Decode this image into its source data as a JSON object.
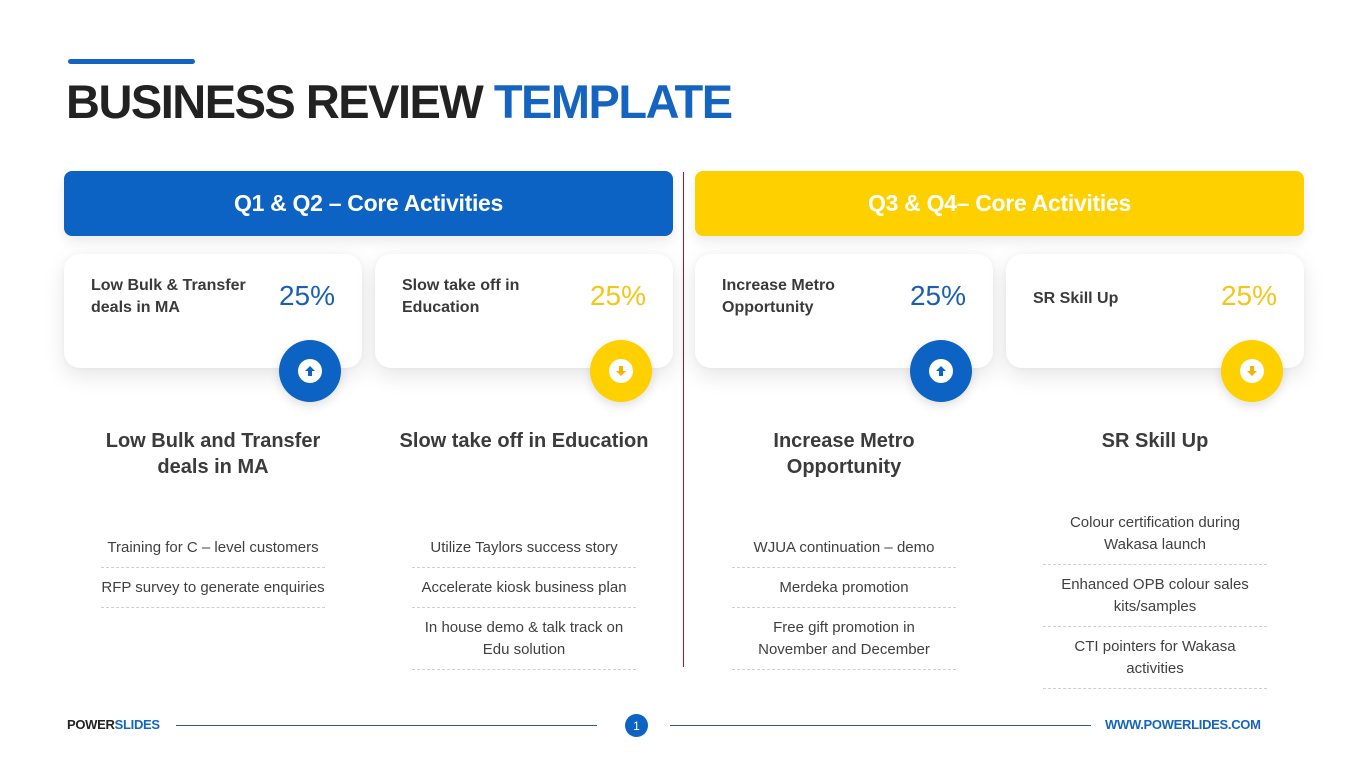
{
  "title": {
    "main": "BUSINESS REVIEW",
    "highlight": "TEMPLATE"
  },
  "colors": {
    "blue": "#0d63c4",
    "yellow": "#fed000",
    "divider": "#b3121e"
  },
  "sections": [
    {
      "header": "Q1 & Q2 – Core Activities",
      "color": "blue"
    },
    {
      "header": "Q3 & Q4– Core Activities",
      "color": "yellow"
    }
  ],
  "cards": [
    {
      "label": "Low Bulk & Transfer deals in MA",
      "percent": "25%",
      "trend": "up",
      "icon": "arrow-up-circle-icon"
    },
    {
      "label": "Slow take off in Education",
      "percent": "25%",
      "trend": "down",
      "icon": "arrow-down-circle-icon"
    },
    {
      "label": "Increase Metro Opportunity",
      "percent": "25%",
      "trend": "up",
      "icon": "arrow-up-circle-icon"
    },
    {
      "label": "SR Skill Up",
      "percent": "25%",
      "trend": "down",
      "icon": "arrow-down-circle-icon"
    }
  ],
  "columns": [
    {
      "title": "Low Bulk and Transfer deals in MA",
      "items": [
        "Training for C – level customers",
        "RFP survey to generate enquiries"
      ]
    },
    {
      "title": "Slow take off in Education",
      "items": [
        "Utilize Taylors success story",
        "Accelerate kiosk business plan",
        "In house demo & talk track on Edu solution"
      ]
    },
    {
      "title": "Increase Metro Opportunity",
      "items": [
        "WJUA continuation – demo",
        "Merdeka promotion",
        "Free gift promotion in November and December"
      ]
    },
    {
      "title": "SR Skill Up",
      "items": [
        "Colour certification during Wakasa launch",
        "Enhanced OPB colour sales kits/samples",
        "CTI pointers for Wakasa activities"
      ]
    }
  ],
  "footer": {
    "brand_main": "POWER",
    "brand_highlight": "SLIDES",
    "page_number": "1",
    "url": "WWW.POWERLIDES.COM"
  }
}
